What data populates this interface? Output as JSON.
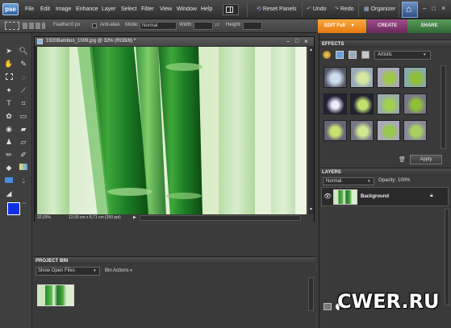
{
  "app": {
    "logo": "pse"
  },
  "menu": [
    "File",
    "Edit",
    "Image",
    "Enhance",
    "Layer",
    "Select",
    "Filter",
    "View",
    "Window",
    "Help"
  ],
  "toolbar": {
    "reset_panels": "Reset Panels",
    "undo": "Undo",
    "redo": "Redo",
    "organizer": "Organizer"
  },
  "modes": {
    "edit": "EDIT Full",
    "create": "CREATE",
    "share": "SHARE"
  },
  "options": {
    "feather_label": "Feather:",
    "feather_value": "0 px",
    "antialias_label": "Anti-alias",
    "mode_label": "Mode:",
    "mode_value": "Normal",
    "width_label": "Width:",
    "height_label": "Height:"
  },
  "document": {
    "title": "1920Bamboo_1009.jpg @ 32% (RGB/8) *",
    "zoom": "32,03%",
    "info": "13,93 cm x 8,71 cm (350 ppi)"
  },
  "project_bin": {
    "title": "PROJECT BIN",
    "filter": "Show Open Files",
    "actions": "Bin Actions"
  },
  "effects": {
    "title": "EFFECTS",
    "category": "Artistic",
    "apply": "Apply"
  },
  "layers": {
    "title": "LAYERS",
    "blend_mode": "Normal",
    "opacity_label": "Opacity:",
    "opacity_value": "100%",
    "items": [
      {
        "name": "Background"
      }
    ]
  },
  "watermark": "CWER.RU",
  "colors": {
    "foreground": "#1030e8",
    "background": "#ffffff",
    "edit_accent": "#f08a20"
  }
}
